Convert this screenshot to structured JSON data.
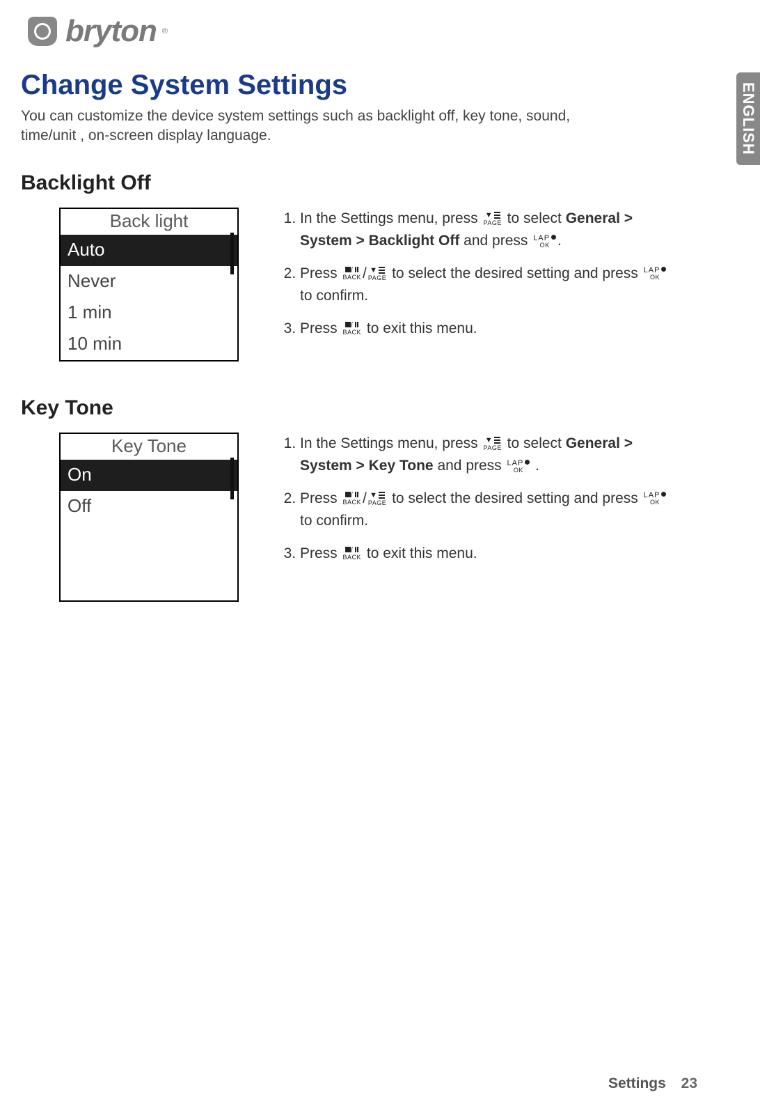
{
  "brand": "bryton",
  "language_tab": "ENGLISH",
  "main_title": "Change System Settings",
  "intro": "You can customize the device system settings such as backlight off, key tone, sound, time/unit , on-screen display language.",
  "sections": {
    "backlight": {
      "heading": "Backlight Off",
      "screen_title": "Back light",
      "options": [
        "Auto",
        "Never",
        "1 min",
        "10 min"
      ],
      "selected_index": 0,
      "steps": {
        "s1_a": "In the Settings menu, press ",
        "s1_b": " to select ",
        "s1_path": "General > System > Backlight Off",
        "s1_c": " and press ",
        "s2_a": "Press ",
        "s2_b": " to select the desired setting and press ",
        "s2_c": " to confirm.",
        "s3_a": "Press ",
        "s3_b": " to exit this menu."
      }
    },
    "keytone": {
      "heading": "Key Tone",
      "screen_title": "Key Tone",
      "options": [
        "On",
        "Off"
      ],
      "selected_index": 0,
      "steps": {
        "s1_a": "In the Settings menu, press ",
        "s1_b": " to select ",
        "s1_path": "General > System > Key Tone",
        "s1_c": " and press ",
        "s2_a": "Press ",
        "s2_b": " to select the desired setting and press ",
        "s2_c": " to confirm.",
        "s3_a": "Press ",
        "s3_b": " to exit this menu."
      }
    }
  },
  "button_labels": {
    "page": "PAGE",
    "back": "BACK",
    "lap": "LAP",
    "ok": "OK"
  },
  "footer_section": "Settings",
  "page_number": "23"
}
